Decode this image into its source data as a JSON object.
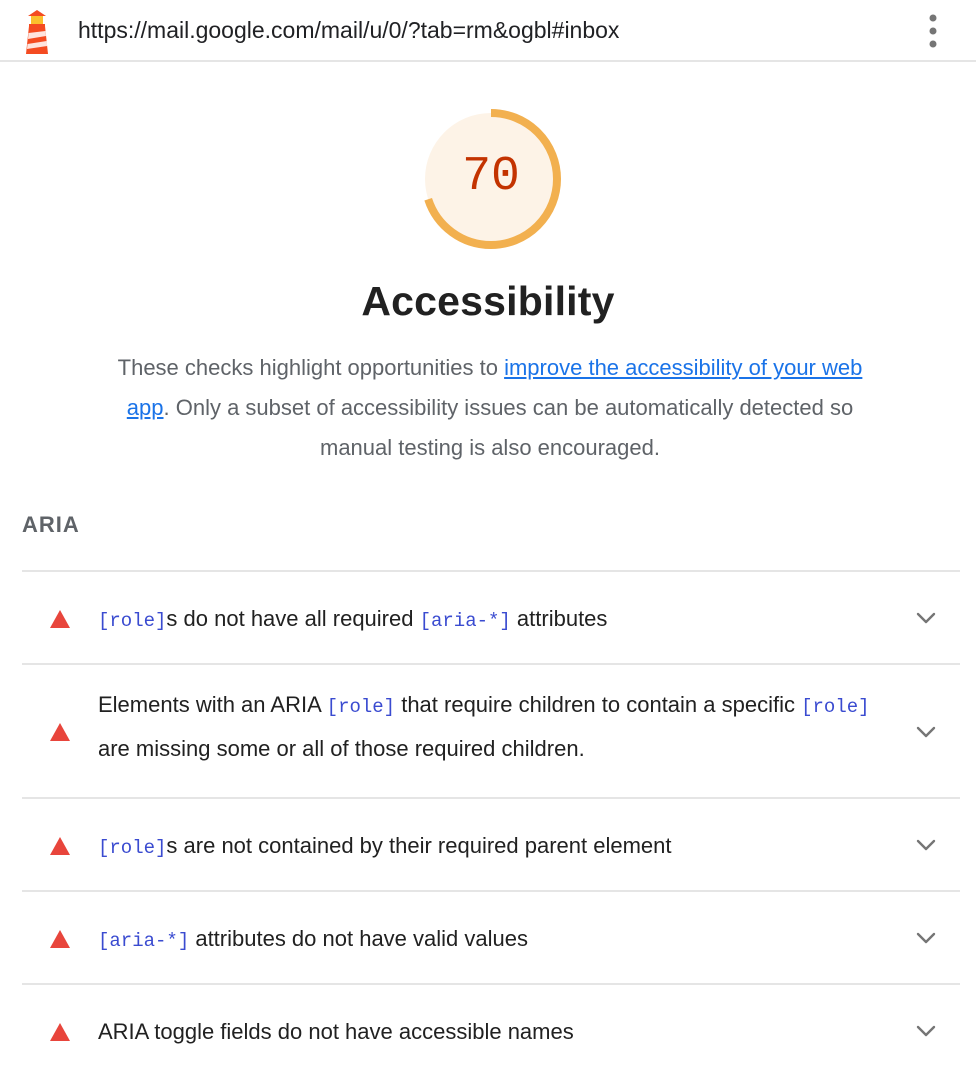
{
  "header": {
    "url": "https://mail.google.com/mail/u/0/?tab=rm&ogbl#inbox",
    "logo_icon": "lighthouse-icon",
    "menu_icon": "kebab-menu-icon"
  },
  "score": {
    "value": "70",
    "fraction": 0.7,
    "color": "#f2b04f",
    "text_color": "#c33300",
    "fill": "#fdf3e7"
  },
  "category": {
    "title": "Accessibility",
    "description_prefix": "These checks highlight opportunities to ",
    "description_link": "improve the accessibility of your web app",
    "description_suffix": ". Only a subset of accessibility issues can be automatically detected so manual testing is also encouraged."
  },
  "group": {
    "title": "ARIA"
  },
  "audits": [
    {
      "parts": [
        {
          "code": "[role]"
        },
        {
          "text": "s do not have all required "
        },
        {
          "code": "[aria-*]"
        },
        {
          "text": " attributes"
        }
      ]
    },
    {
      "parts": [
        {
          "text": "Elements with an ARIA "
        },
        {
          "code": "[role]"
        },
        {
          "text": " that require children to contain a specific "
        },
        {
          "code": "[role]"
        },
        {
          "text": " are missing some or all of those required children."
        }
      ]
    },
    {
      "parts": [
        {
          "code": "[role]"
        },
        {
          "text": "s are not contained by their required parent element"
        }
      ]
    },
    {
      "parts": [
        {
          "code": "[aria-*]"
        },
        {
          "text": " attributes do not have valid values"
        }
      ]
    },
    {
      "parts": [
        {
          "text": "ARIA toggle fields do not have accessible names"
        }
      ]
    }
  ],
  "colors": {
    "fail": "#e8453c",
    "link": "#1a73e8",
    "code": "#3a4bd0"
  }
}
